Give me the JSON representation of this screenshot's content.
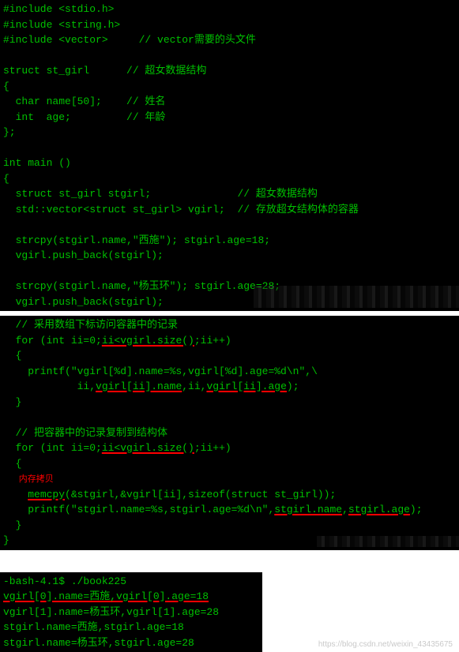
{
  "block1": {
    "l1": "#include <stdio.h>",
    "l2": "#include <string.h>",
    "l3": "#include <vector>     // vector需要的头文件",
    "l4": "",
    "l5": "struct st_girl      // 超女数据结构",
    "l6": "{",
    "l7": "  char name[50];    // 姓名",
    "l8": "  int  age;         // 年龄",
    "l9": "};",
    "l10": "",
    "l11": "int main ()",
    "l12": "{",
    "l13": "  struct st_girl stgirl;              // 超女数据结构",
    "l14": "  std::vector<struct st_girl> vgirl;  // 存放超女结构体的容器",
    "l15": "",
    "l16": "  strcpy(stgirl.name,\"西施\"); stgirl.age=18;",
    "l17": "  vgirl.push_back(stgirl);",
    "l18": "",
    "l19": "  strcpy(stgirl.name,\"杨玉环\"); stgirl.age=28;",
    "l20": "  vgirl.push_back(stgirl);"
  },
  "block2": {
    "l1": "  // 采用数组下标访问容器中的记录",
    "l2a": "  for (int ii=0;",
    "l2u": "ii<vgirl.size()",
    "l2b": ";ii++)",
    "l3": "  {",
    "l4": "    printf(\"vgirl[%d].name=%s,vgirl[%d].age=%d\\n\",\\",
    "l5a": "            ii,",
    "l5u1": "vgirl[ii].name",
    "l5b": ",ii,",
    "l5u2": "vgirl[ii].age",
    "l5c": ");",
    "l6": "  }",
    "l7": "",
    "l8": "  // 把容器中的记录复制到结构体",
    "l9a": "  for (int ii=0;",
    "l9u": "ii<vgirl.size()",
    "l9b": ";ii++)",
    "l10": "  {",
    "anno": "   内存拷贝",
    "l11a": "    ",
    "l11u": "memcpy",
    "l11b": "(&stgirl,&vgirl[ii],sizeof(struct st_girl));",
    "l12a": "    printf(\"stgirl.name=%s,stgirl.age=%d\\n\",",
    "l12u1": "stgirl.name",
    "l12b": ",",
    "l12u2": "stgirl.age",
    "l12c": ");",
    "l13": "  }",
    "l14": "}"
  },
  "block3": {
    "l1": "-bash-4.1$ ./book225",
    "l2": "vgirl[0].name=西施,vgirl[0].age=18",
    "l3": "vgirl[1].name=杨玉环,vgirl[1].age=28",
    "l4": "stgirl.name=西施,stgirl.age=18",
    "l5": "stgirl.name=杨玉环,stgirl.age=28"
  },
  "watermark": "https://blog.csdn.net/weixin_43435675"
}
